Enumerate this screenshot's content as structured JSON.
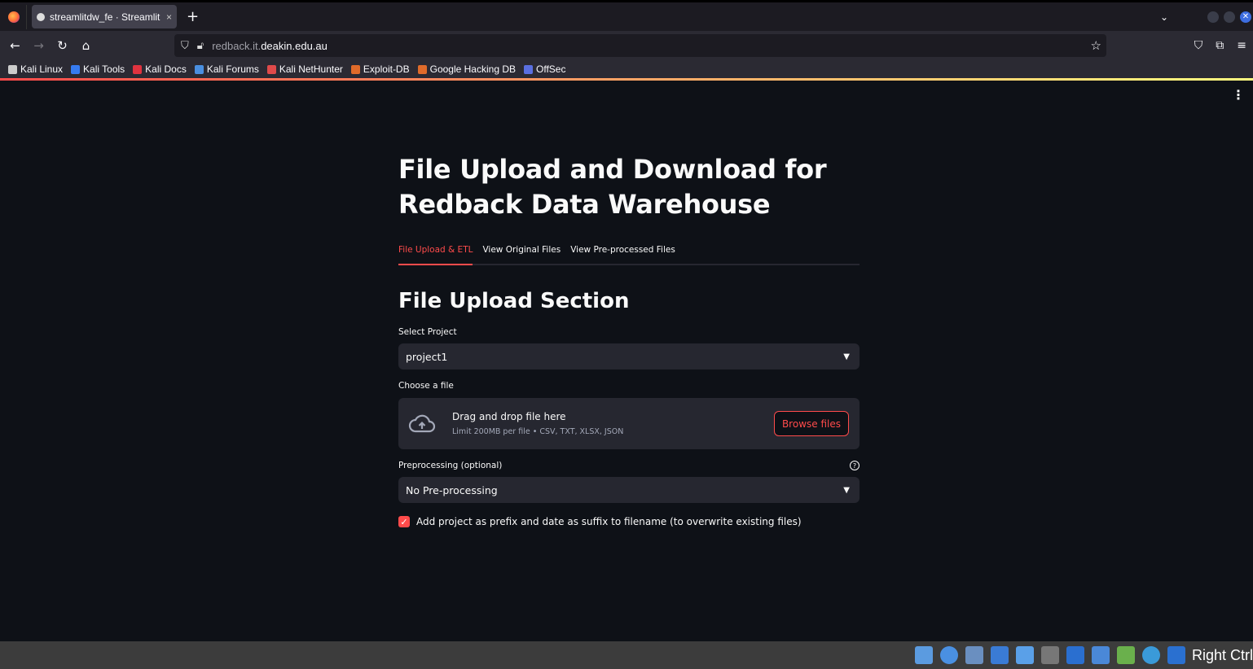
{
  "browser": {
    "tab_title": "streamlitdw_fe · Streamlit",
    "tab_close": "×",
    "new_tab": "+",
    "list_all_tabs": "⌄",
    "url_dim_prefix": "redback.it.",
    "url_domain": "deakin.edu.au",
    "bookmarks": [
      {
        "label": "Kali Linux",
        "color": "#cccccc"
      },
      {
        "label": "Kali Tools",
        "color": "#367bf0"
      },
      {
        "label": "Kali Docs",
        "color": "#e0333f"
      },
      {
        "label": "Kali Forums",
        "color": "#4a8fe0"
      },
      {
        "label": "Kali NetHunter",
        "color": "#e04a4a"
      },
      {
        "label": "Exploit-DB",
        "color": "#e06b2a"
      },
      {
        "label": "Google Hacking DB",
        "color": "#e06b2a"
      },
      {
        "label": "OffSec",
        "color": "#5a6fe0"
      }
    ]
  },
  "app": {
    "title": "File Upload and Download for Redback Data Warehouse",
    "tabs": [
      {
        "label": "File Upload & ETL",
        "active": true
      },
      {
        "label": "View Original Files",
        "active": false
      },
      {
        "label": "View Pre-processed Files",
        "active": false
      }
    ],
    "section_title": "File Upload Section",
    "project_select": {
      "label": "Select Project",
      "value": "project1"
    },
    "file_uploader": {
      "label": "Choose a file",
      "drop_text": "Drag and drop file here",
      "limit_text": "Limit 200MB per file • CSV, TXT, XLSX, JSON",
      "browse_label": "Browse files"
    },
    "preprocessing_select": {
      "label": "Preprocessing (optional)",
      "value": "No Pre-processing",
      "help": "?"
    },
    "rename_checkbox": {
      "label": "Add project as prefix and date as suffix to filename (to overwrite existing files)",
      "checked": true
    },
    "accent_color": "#ff4b4b"
  },
  "taskbar": {
    "host_key_label": "Right Ctrl"
  }
}
